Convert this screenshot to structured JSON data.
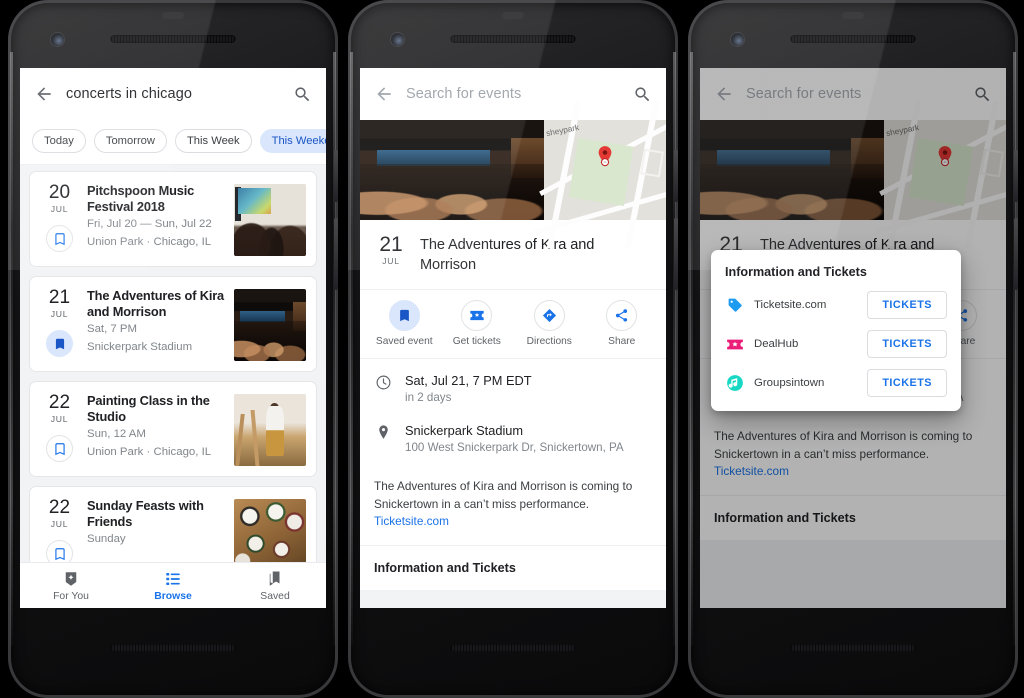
{
  "colors": {
    "accent": "#1a73e8",
    "chip_active_bg": "#d9e6fb",
    "chip_active_text": "#1a56c5",
    "pin_red": "#e53935",
    "tag_blue": "#1d9bf0",
    "dealhub_pink": "#ea1e79",
    "groupsintown_teal": "#18d8c4",
    "text_primary": "#202124",
    "text_secondary": "#80868b"
  },
  "phone1": {
    "search": {
      "query": "concerts in chicago",
      "back_icon": "back-arrow-icon",
      "search_icon": "search-icon"
    },
    "chips": [
      {
        "label": "Today",
        "active": false
      },
      {
        "label": "Tomorrow",
        "active": false
      },
      {
        "label": "This Week",
        "active": false
      },
      {
        "label": "This Weekend",
        "active": true
      }
    ],
    "events": [
      {
        "day": "20",
        "month": "JUL",
        "title": "Pitchspoon Music Festival 2018",
        "date": "Fri, Jul 20 — Sun, Jul 22",
        "venue": "Union Park · Chicago, IL",
        "saved": false
      },
      {
        "day": "21",
        "month": "JUL",
        "title": "The Adventures of Kira and Morrison",
        "date": "Sat, 7 PM",
        "venue": "Snickerpark Stadium",
        "saved": true
      },
      {
        "day": "22",
        "month": "JUL",
        "title": "Painting Class in the Studio",
        "date": "Sun, 12 AM",
        "venue": "Union Park · Chicago, IL",
        "saved": false
      },
      {
        "day": "22",
        "month": "JUL",
        "title": "Sunday Feasts with Friends",
        "date": "Sunday",
        "venue": "",
        "saved": false
      }
    ],
    "bottom_nav": [
      {
        "label": "For You",
        "icon": "sparkle-badge-icon",
        "selected": false
      },
      {
        "label": "Browse",
        "icon": "list-icon",
        "selected": true
      },
      {
        "label": "Saved",
        "icon": "bookmarks-icon",
        "selected": false
      }
    ]
  },
  "phone2": {
    "search": {
      "placeholder": "Search for events",
      "back_icon": "back-arrow-icon",
      "search_icon": "search-icon"
    },
    "map_label": "sheypark",
    "event": {
      "day": "21",
      "month": "JUL",
      "title": "The Adventures of Kira and Morrison",
      "time_primary": "Sat, Jul 21, 7 PM EDT",
      "time_secondary": "in 2 days",
      "venue_name": "Snickerpark Stadium",
      "venue_address": "100 West Snickerpark Dr, Snickertown, PA",
      "description": "The Adventures of Kira and Morrison is coming to Snickertown in a can’t miss performance.",
      "description_link": "Ticketsite.com",
      "section_title": "Information and Tickets"
    },
    "actions": [
      {
        "label": "Saved event",
        "icon": "bookmark-icon",
        "active": true
      },
      {
        "label": "Get tickets",
        "icon": "ticket-icon",
        "active": false
      },
      {
        "label": "Directions",
        "icon": "directions-icon",
        "active": false
      },
      {
        "label": "Share",
        "icon": "share-icon",
        "active": false
      }
    ]
  },
  "phone3": {
    "dialog": {
      "title": "Information and Tickets",
      "providers": [
        {
          "name": "Ticketsite.com",
          "icon": "tag-icon",
          "button": "TICKETS"
        },
        {
          "name": "DealHub",
          "icon": "ticket-star-icon",
          "button": "TICKETS"
        },
        {
          "name": "Groupsintown",
          "icon": "music-note-circle-icon",
          "button": "TICKETS"
        }
      ]
    }
  }
}
